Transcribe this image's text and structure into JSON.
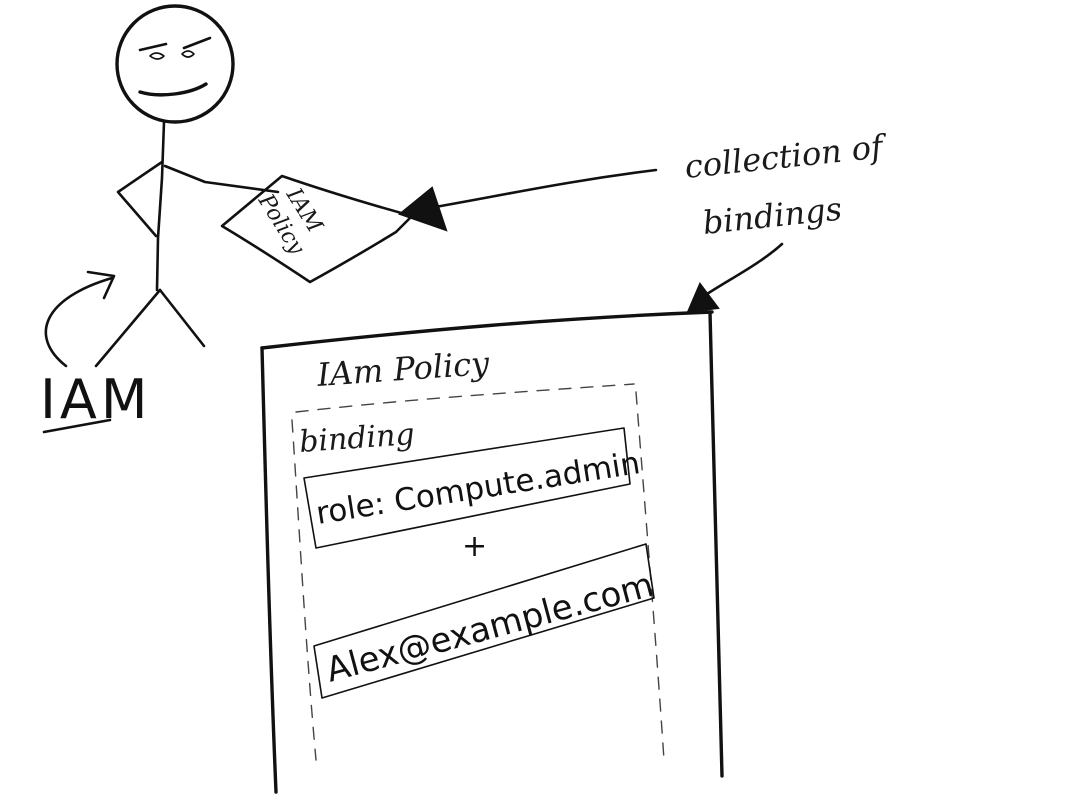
{
  "diagram": {
    "actor_label": "IAM",
    "held_document_label": [
      "IAM",
      "Policy"
    ],
    "annotation": [
      "collection of",
      "bindings"
    ],
    "policy_box": {
      "title": "IAm Policy",
      "binding": {
        "label": "binding",
        "role": "role: Compute.admin",
        "connector": "+",
        "member": "Alex@example.com"
      }
    }
  }
}
